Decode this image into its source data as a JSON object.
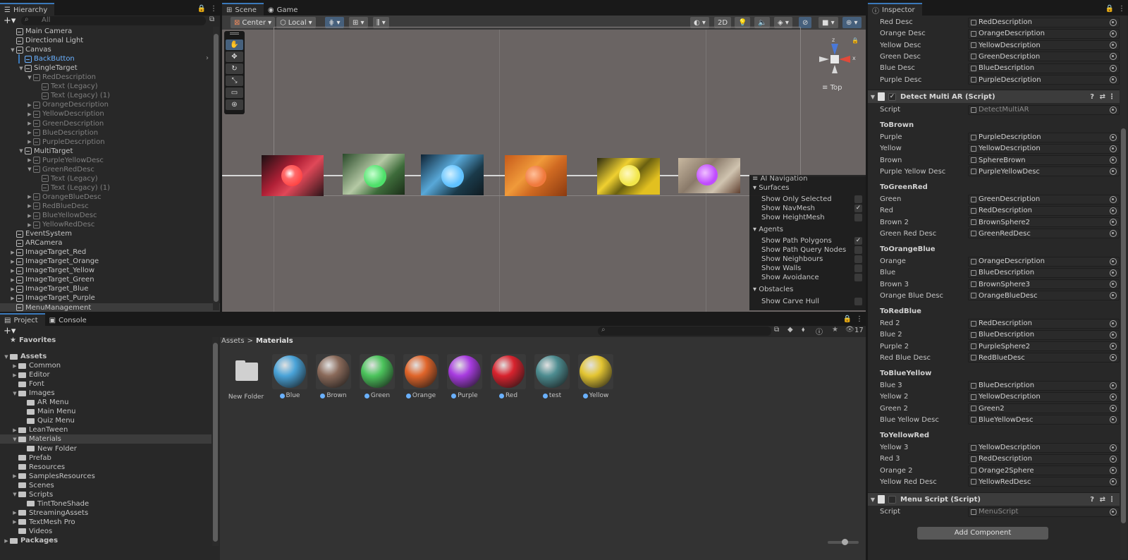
{
  "hierarchy": {
    "tab": "Hierarchy",
    "search_placeholder": "All",
    "items": [
      {
        "label": "Main Camera",
        "depth": 1,
        "arrow": "",
        "style": ""
      },
      {
        "label": "Directional Light",
        "depth": 1,
        "arrow": "",
        "style": ""
      },
      {
        "label": "Canvas",
        "depth": 1,
        "arrow": "down",
        "style": ""
      },
      {
        "label": "BackButton",
        "depth": 2,
        "arrow": "",
        "style": "sel"
      },
      {
        "label": "SingleTarget",
        "depth": 2,
        "arrow": "down",
        "style": ""
      },
      {
        "label": "RedDescription",
        "depth": 3,
        "arrow": "down",
        "style": "dim"
      },
      {
        "label": "Text (Legacy)",
        "depth": 4,
        "arrow": "",
        "style": "dim"
      },
      {
        "label": "Text (Legacy) (1)",
        "depth": 4,
        "arrow": "",
        "style": "dim"
      },
      {
        "label": "OrangeDescription",
        "depth": 3,
        "arrow": "right",
        "style": "dim"
      },
      {
        "label": "YellowDescription",
        "depth": 3,
        "arrow": "right",
        "style": "dim"
      },
      {
        "label": "GreenDescription",
        "depth": 3,
        "arrow": "right",
        "style": "dim"
      },
      {
        "label": "BlueDescription",
        "depth": 3,
        "arrow": "right",
        "style": "dim"
      },
      {
        "label": "PurpleDescription",
        "depth": 3,
        "arrow": "right",
        "style": "dim"
      },
      {
        "label": "MultiTarget",
        "depth": 2,
        "arrow": "down",
        "style": ""
      },
      {
        "label": "PurpleYellowDesc",
        "depth": 3,
        "arrow": "right",
        "style": "dim"
      },
      {
        "label": "GreenRedDesc",
        "depth": 3,
        "arrow": "down",
        "style": "dim"
      },
      {
        "label": "Text (Legacy)",
        "depth": 4,
        "arrow": "",
        "style": "dim"
      },
      {
        "label": "Text (Legacy) (1)",
        "depth": 4,
        "arrow": "",
        "style": "dim"
      },
      {
        "label": "OrangeBlueDesc",
        "depth": 3,
        "arrow": "right",
        "style": "dim"
      },
      {
        "label": "RedBlueDesc",
        "depth": 3,
        "arrow": "right",
        "style": "dim"
      },
      {
        "label": "BlueYellowDesc",
        "depth": 3,
        "arrow": "right",
        "style": "dim"
      },
      {
        "label": "YellowRedDesc",
        "depth": 3,
        "arrow": "right",
        "style": "dim"
      },
      {
        "label": "EventSystem",
        "depth": 1,
        "arrow": "",
        "style": ""
      },
      {
        "label": "ARCamera",
        "depth": 1,
        "arrow": "",
        "style": ""
      },
      {
        "label": "ImageTarget_Red",
        "depth": 1,
        "arrow": "right",
        "style": ""
      },
      {
        "label": "ImageTarget_Orange",
        "depth": 1,
        "arrow": "right",
        "style": ""
      },
      {
        "label": "ImageTarget_Yellow",
        "depth": 1,
        "arrow": "right",
        "style": ""
      },
      {
        "label": "ImageTarget_Green",
        "depth": 1,
        "arrow": "right",
        "style": ""
      },
      {
        "label": "ImageTarget_Blue",
        "depth": 1,
        "arrow": "right",
        "style": ""
      },
      {
        "label": "ImageTarget_Purple",
        "depth": 1,
        "arrow": "right",
        "style": ""
      },
      {
        "label": "MenuManagement",
        "depth": 1,
        "arrow": "",
        "style": "hl"
      }
    ]
  },
  "scene": {
    "tab_scene": "Scene",
    "tab_game": "Game",
    "center": "Center",
    "local": "Local",
    "btn_2d": "2D",
    "gizmo_view": "Top",
    "gizmo_z": "z",
    "gizmo_x": "x",
    "ai_nav": {
      "title": "AI Navigation",
      "surfaces": "Surfaces",
      "show_only_selected": "Show Only Selected",
      "show_navmesh": "Show NavMesh",
      "show_heightmesh": "Show HeightMesh",
      "agents": "Agents",
      "show_path_polygons": "Show Path Polygons",
      "show_path_query_nodes": "Show Path Query Nodes",
      "show_neighbours": "Show Neighbours",
      "show_walls": "Show Walls",
      "show_avoidance": "Show Avoidance",
      "obstacles": "Obstacles",
      "show_carve_hull": "Show Carve Hull",
      "check": "✓"
    },
    "colors": {
      "red": "#ff4d4d",
      "green": "#4ee06a",
      "blue": "#5fc1ff",
      "orange": "#f07a3e",
      "yellow": "#f2e64a",
      "purple": "#c04cff"
    }
  },
  "project": {
    "tab_project": "Project",
    "tab_console": "Console",
    "count": "17",
    "breadcrumb_root": "Assets",
    "breadcrumb_sep": ">",
    "breadcrumb_current": "Materials",
    "tree": [
      {
        "label": "Favorites",
        "depth": 0,
        "arrow": "",
        "bold": true,
        "icon": "star"
      },
      {
        "label": "Assets",
        "depth": 0,
        "arrow": "down",
        "bold": true,
        "icon": "folder"
      },
      {
        "label": "Common",
        "depth": 1,
        "arrow": "right",
        "bold": false,
        "icon": "folder"
      },
      {
        "label": "Editor",
        "depth": 1,
        "arrow": "right",
        "bold": false,
        "icon": "folder"
      },
      {
        "label": "Font",
        "depth": 1,
        "arrow": "",
        "bold": false,
        "icon": "folder"
      },
      {
        "label": "Images",
        "depth": 1,
        "arrow": "down",
        "bold": false,
        "icon": "folder"
      },
      {
        "label": "AR Menu",
        "depth": 2,
        "arrow": "",
        "bold": false,
        "icon": "folder"
      },
      {
        "label": "Main Menu",
        "depth": 2,
        "arrow": "",
        "bold": false,
        "icon": "folder"
      },
      {
        "label": "Quiz Menu",
        "depth": 2,
        "arrow": "",
        "bold": false,
        "icon": "folder"
      },
      {
        "label": "LeanTween",
        "depth": 1,
        "arrow": "right",
        "bold": false,
        "icon": "folder"
      },
      {
        "label": "Materials",
        "depth": 1,
        "arrow": "down",
        "bold": false,
        "icon": "folder",
        "hl": true
      },
      {
        "label": "New Folder",
        "depth": 2,
        "arrow": "",
        "bold": false,
        "icon": "folder"
      },
      {
        "label": "Prefab",
        "depth": 1,
        "arrow": "",
        "bold": false,
        "icon": "folder"
      },
      {
        "label": "Resources",
        "depth": 1,
        "arrow": "",
        "bold": false,
        "icon": "folder"
      },
      {
        "label": "SamplesResources",
        "depth": 1,
        "arrow": "right",
        "bold": false,
        "icon": "folder"
      },
      {
        "label": "Scenes",
        "depth": 1,
        "arrow": "",
        "bold": false,
        "icon": "folder"
      },
      {
        "label": "Scripts",
        "depth": 1,
        "arrow": "down",
        "bold": false,
        "icon": "folder"
      },
      {
        "label": "TintToneShade",
        "depth": 2,
        "arrow": "",
        "bold": false,
        "icon": "folder"
      },
      {
        "label": "StreamingAssets",
        "depth": 1,
        "arrow": "right",
        "bold": false,
        "icon": "folder"
      },
      {
        "label": "TextMesh Pro",
        "depth": 1,
        "arrow": "right",
        "bold": false,
        "icon": "folder"
      },
      {
        "label": "Videos",
        "depth": 1,
        "arrow": "",
        "bold": false,
        "icon": "folder"
      },
      {
        "label": "Packages",
        "depth": 0,
        "arrow": "right",
        "bold": true,
        "icon": "folder"
      }
    ],
    "assets": [
      {
        "label": "New Folder",
        "type": "folder",
        "color": ""
      },
      {
        "label": "Blue",
        "type": "material",
        "color": "#4aa3d8"
      },
      {
        "label": "Brown",
        "type": "material",
        "color": "#8a6a5a"
      },
      {
        "label": "Green",
        "type": "material",
        "color": "#4cc45c"
      },
      {
        "label": "Orange",
        "type": "material",
        "color": "#e0652a"
      },
      {
        "label": "Purple",
        "type": "material",
        "color": "#a83ce0"
      },
      {
        "label": "Red",
        "type": "material",
        "color": "#d8232e"
      },
      {
        "label": "test",
        "type": "material",
        "color": "#4d8c90"
      },
      {
        "label": "Yellow",
        "type": "material",
        "color": "#e3c532"
      }
    ]
  },
  "inspector": {
    "tab": "Inspector",
    "top_rows": [
      {
        "k": "Red Desc",
        "v": "RedDescription"
      },
      {
        "k": "Orange Desc",
        "v": "OrangeDescription"
      },
      {
        "k": "Yellow Desc",
        "v": "YellowDescription"
      },
      {
        "k": "Green Desc",
        "v": "GreenDescription"
      },
      {
        "k": "Blue Desc",
        "v": "BlueDescription"
      },
      {
        "k": "Purple Desc",
        "v": "PurpleDescription"
      }
    ],
    "detect_title": "Detect Multi AR (Script)",
    "script_label": "Script",
    "detect_script": "DetectMultiAR",
    "groups": [
      {
        "title": "ToBrown",
        "rows": [
          {
            "k": "Purple",
            "v": "PurpleDescription"
          },
          {
            "k": "Yellow",
            "v": "YellowDescription"
          },
          {
            "k": "Brown",
            "v": "SphereBrown"
          },
          {
            "k": "Purple Yellow Desc",
            "v": "PurpleYellowDesc"
          }
        ]
      },
      {
        "title": "ToGreenRed",
        "rows": [
          {
            "k": "Green",
            "v": "GreenDescription"
          },
          {
            "k": "Red",
            "v": "RedDescription"
          },
          {
            "k": "Brown 2",
            "v": "BrownSphere2"
          },
          {
            "k": "Green Red Desc",
            "v": "GreenRedDesc"
          }
        ]
      },
      {
        "title": "ToOrangeBlue",
        "rows": [
          {
            "k": "Orange",
            "v": "OrangeDescription"
          },
          {
            "k": "Blue",
            "v": "BlueDescription"
          },
          {
            "k": "Brown 3",
            "v": "BrownSphere3"
          },
          {
            "k": "Orange Blue Desc",
            "v": "OrangeBlueDesc"
          }
        ]
      },
      {
        "title": "ToRedBlue",
        "rows": [
          {
            "k": "Red 2",
            "v": "RedDescription"
          },
          {
            "k": "Blue 2",
            "v": "BlueDescription"
          },
          {
            "k": "Purple 2",
            "v": "PurpleSphere2"
          },
          {
            "k": "Red Blue Desc",
            "v": "RedBlueDesc"
          }
        ]
      },
      {
        "title": "ToBlueYellow",
        "rows": [
          {
            "k": "Blue 3",
            "v": "BlueDescription"
          },
          {
            "k": "Yellow 2",
            "v": "YellowDescription"
          },
          {
            "k": "Green 2",
            "v": "Green2"
          },
          {
            "k": "Blue Yellow Desc",
            "v": "BlueYellowDesc"
          }
        ]
      },
      {
        "title": "ToYellowRed",
        "rows": [
          {
            "k": "Yellow 3",
            "v": "YellowDescription"
          },
          {
            "k": "Red 3",
            "v": "RedDescription"
          },
          {
            "k": "Orange 2",
            "v": "Orange2Sphere"
          },
          {
            "k": "Yellow Red Desc",
            "v": "YellowRedDesc"
          }
        ]
      }
    ],
    "menu_title": "Menu Script (Script)",
    "menu_script": "MenuScript",
    "add_component": "Add Component"
  }
}
